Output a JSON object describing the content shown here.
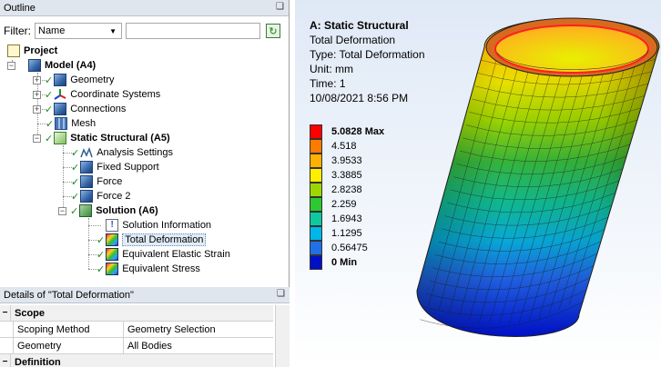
{
  "outline": {
    "title": "Outline",
    "pin": "❑",
    "filter_label": "Filter:",
    "filter_value": "Name",
    "tree": [
      {
        "label": "Project",
        "level": 0,
        "bold": true
      },
      {
        "label": "Model (A4)",
        "level": 1,
        "bold": true
      },
      {
        "label": "Geometry",
        "level": 2
      },
      {
        "label": "Coordinate Systems",
        "level": 2
      },
      {
        "label": "Connections",
        "level": 2
      },
      {
        "label": "Mesh",
        "level": 2
      },
      {
        "label": "Static Structural (A5)",
        "level": 2,
        "bold": true
      },
      {
        "label": "Analysis Settings",
        "level": 3
      },
      {
        "label": "Fixed Support",
        "level": 3
      },
      {
        "label": "Force",
        "level": 3
      },
      {
        "label": "Force 2",
        "level": 3
      },
      {
        "label": "Solution (A6)",
        "level": 3,
        "bold": true
      },
      {
        "label": "Solution Information",
        "level": 4
      },
      {
        "label": "Total Deformation",
        "level": 4,
        "selected": true
      },
      {
        "label": "Equivalent Elastic Strain",
        "level": 4
      },
      {
        "label": "Equivalent Stress",
        "level": 4
      }
    ]
  },
  "details": {
    "title": "Details of \"Total Deformation\"",
    "sections": [
      {
        "name": "Scope",
        "rows": [
          {
            "key": "Scoping Method",
            "value": "Geometry Selection"
          },
          {
            "key": "Geometry",
            "value": "All Bodies"
          }
        ]
      },
      {
        "name": "Definition",
        "rows": []
      }
    ]
  },
  "viewport": {
    "title": "A: Static Structural",
    "lines": [
      "Total Deformation",
      "Type: Total Deformation",
      "Unit: mm",
      "Time: 1",
      "10/08/2021 8:56 PM"
    ],
    "legend": [
      {
        "label": "5.0828 Max",
        "color": "#ff0000",
        "bold": true
      },
      {
        "label": "4.518",
        "color": "#ff7a00"
      },
      {
        "label": "3.9533",
        "color": "#ffb000"
      },
      {
        "label": "3.3885",
        "color": "#ffee00"
      },
      {
        "label": "2.8238",
        "color": "#9cd800"
      },
      {
        "label": "2.259",
        "color": "#2ec830"
      },
      {
        "label": "1.6943",
        "color": "#10c8a0"
      },
      {
        "label": "1.1295",
        "color": "#00b8e8"
      },
      {
        "label": "0.56475",
        "color": "#2070e8"
      },
      {
        "label": "0 Min",
        "color": "#0010c8",
        "bold": true
      }
    ]
  }
}
